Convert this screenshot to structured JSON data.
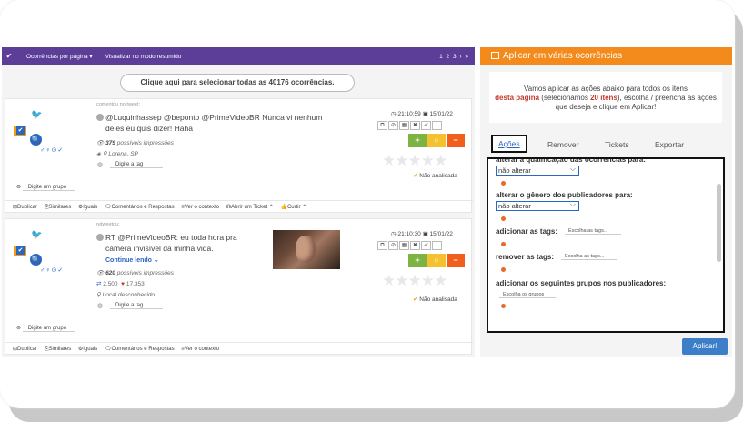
{
  "topbar": {
    "check": "✔",
    "per_page": "Ocorrências por página ▾",
    "summary_mode": "Visualizar no modo resumido",
    "pagination": "1 2 3 › »"
  },
  "select_all": {
    "prefix": "Clique aqui para selecionar todas as ",
    "count": "40176",
    "suffix": " ocorrências."
  },
  "posts": [
    {
      "action_label": "comentou no tweet:",
      "text_line1": "@Luquinhassep @beponto @PrimeVideoBR Nunca vi nenhum",
      "text_line2": "deles eu quis dizer! Haha",
      "impressions_value": "379",
      "impressions_label": "possíveis impressões",
      "location": "Lorena, SP",
      "tag_placeholder": "Digite a tag",
      "time": "21:10:59",
      "date": "15/01/22",
      "status": "Não analisada",
      "group_placeholder": "Digite um grupo",
      "footer": [
        "⊞Duplicar",
        "⎘Similares",
        "⚙Iguais",
        "🗨Comentários e Respostas",
        "≡Ver o contexto",
        "☊Abrir um Ticket ⌃",
        "👍Curtir ⌃"
      ]
    },
    {
      "action_label": "retweetou:",
      "text_line1": "RT @PrimeVideoBR: eu toda hora pra",
      "text_line2": "câmera invisível da minha vida.",
      "more": "Continue lendo ⌄",
      "impressions_value": "620",
      "impressions_label": "possíveis impressões",
      "retweets": "2.500",
      "likes": "17.353",
      "location": "Local desconhecido",
      "tag_placeholder": "Digite a tag",
      "time": "21:10:30",
      "date": "15/01/22",
      "status": "Não analisada",
      "group_placeholder": "Digite um grupo",
      "footer": [
        "⊞Duplicar",
        "⎘Similares",
        "⚙Iguais",
        "🗨Comentários e Respostas",
        "≡Ver o contexto"
      ]
    }
  ],
  "icons": {
    "post_toolbar": [
      "⧉",
      "⊘",
      "▦",
      "✖",
      "≺",
      "i"
    ],
    "actions": [
      "+",
      "○",
      "−"
    ],
    "stars": "★★★★★",
    "gender": "♂♀⊙✓"
  },
  "right_panel": {
    "title": "Aplicar em várias ocorrências",
    "info_part1": "Vamos aplicar as ações abaixo para todos os itens",
    "info_red": "desta página",
    "info_part2": " (selecionamos ",
    "info_count": "20 itens",
    "info_part3": "), escolha / preencha as ações que deseja e clique em Aplicar!",
    "tabs": [
      "Ações",
      "Remover",
      "Tickets",
      "Exportar"
    ],
    "fields": {
      "qualificacao_label": "alterar a qualificação das ocorrências para:",
      "qualificacao_value": "não alterar",
      "genero_label": "alterar o gênero dos publicadores para:",
      "genero_value": "não alterar",
      "add_tags_label": "adicionar as tags:",
      "add_tags_placeholder": "Escolha as tags...",
      "remove_tags_label": "remover as tags:",
      "remove_tags_placeholder": "Escolha as tags...",
      "groups_label": "adicionar os seguintes grupos nos publicadores:",
      "groups_placeholder": "Escolha os grupos"
    },
    "apply_label": "Aplicar!"
  },
  "colors": {
    "topbar": "#5c3e99",
    "right_header": "#f28a1c",
    "accent": "#2a66c4",
    "positive": "#7cb342",
    "neutral": "#f6c12f",
    "negative": "#f25f1c"
  }
}
